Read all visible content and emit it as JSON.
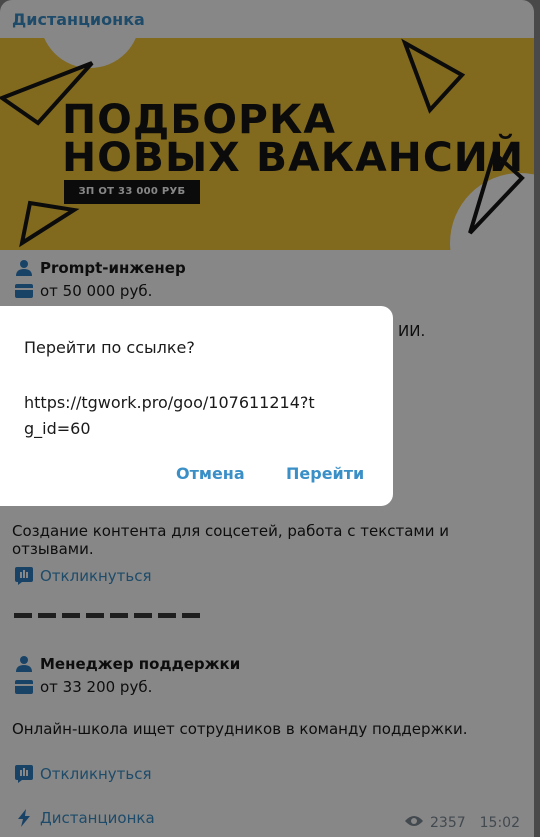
{
  "channel_name": "Дистанционка",
  "banner": {
    "line1": "ПОДБОРКА",
    "line2": "НОВЫХ ВАКАНСИЙ",
    "salary_badge": "ЗП ОТ 33 000 РУБ"
  },
  "job1": {
    "title": "Prompt-инженер",
    "salary": "от 50 000 руб.",
    "desc_peek": "ИИ."
  },
  "job2": {
    "desc": "Создание контента для соцсетей, работа с текстами и отзывами.",
    "respond": "Откликнуться"
  },
  "job3": {
    "title": "Менеджер поддержки",
    "salary": "от 33 200 руб.",
    "desc": "Онлайн-школа ищет сотрудников в команду поддержки.",
    "respond": "Откликнуться"
  },
  "footer": {
    "channel_link": "Дистанционка",
    "views": "2357",
    "time": "15:02"
  },
  "dialog": {
    "title": "Перейти по ссылке?",
    "url": "https://tgwork.pro/goo/107611214?tg_id=60",
    "cancel": "Отмена",
    "go": "Перейти"
  },
  "colors": {
    "accent": "#3a8fc7",
    "banner_bg": "#f3c63a",
    "overlay": "rgba(0,0,0,0.47)"
  }
}
